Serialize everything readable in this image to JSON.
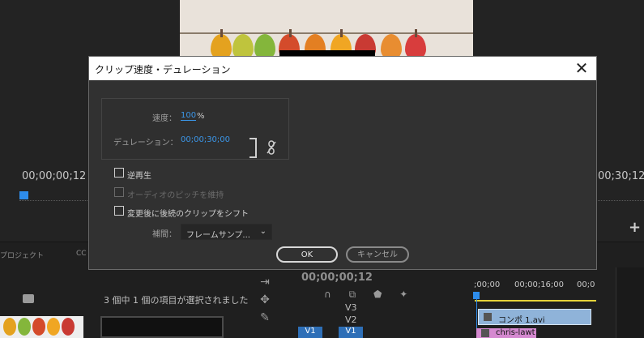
{
  "dialog": {
    "title": "クリップ速度・デュレーション",
    "speed_label": "速度：",
    "speed_value": "100",
    "speed_unit": "%",
    "duration_label": "デュレーション：",
    "duration_value": "00;00;30;00",
    "checkboxes": [
      {
        "label": "逆再生",
        "checked": false,
        "enabled": true
      },
      {
        "label": "オーディオのピッチを維持",
        "checked": false,
        "enabled": false
      },
      {
        "label": "変更後に後続のクリップをシフト",
        "checked": false,
        "enabled": true
      }
    ],
    "interpolation_label": "補間：",
    "interpolation_value": "フレームサンプ...",
    "ok_label": "OK",
    "cancel_label": "キャンセル"
  },
  "monitor": {
    "timecode_left": "00;00;00;12",
    "timecode_right": "00;30;12"
  },
  "project": {
    "tab_label": "プロジェクト",
    "tab_label_2": "CC",
    "selection_text": "3 個中 1 個の項目が選択されました"
  },
  "timeline": {
    "timecode": "00;00;00;12",
    "ruler": [
      ";00;00",
      "00;00;16;00",
      "00;0"
    ],
    "tracks": [
      "V3",
      "V2",
      "V1"
    ],
    "clips": [
      {
        "name": "コンポ 1.avi"
      },
      {
        "name": "chris-lawt"
      }
    ]
  },
  "colors": {
    "accent": "#3b96e8",
    "dialog_bg": "#313131",
    "clip_comp": "#8fb3d9",
    "clip_chris": "#d589d0"
  },
  "icons": [
    "close-icon",
    "link-toggle-icon",
    "chevron-down-icon",
    "plus-icon",
    "folder-icon",
    "wrench-icon"
  ]
}
